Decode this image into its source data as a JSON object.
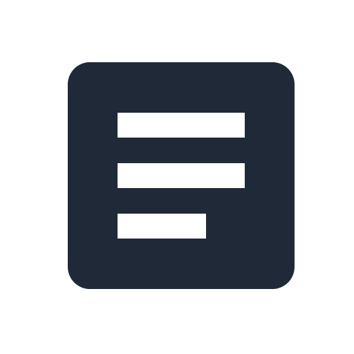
{
  "icon": {
    "name": "text-lines-icon",
    "background_color": "#202938",
    "line_color": "#ffffff",
    "line_count": 3
  }
}
